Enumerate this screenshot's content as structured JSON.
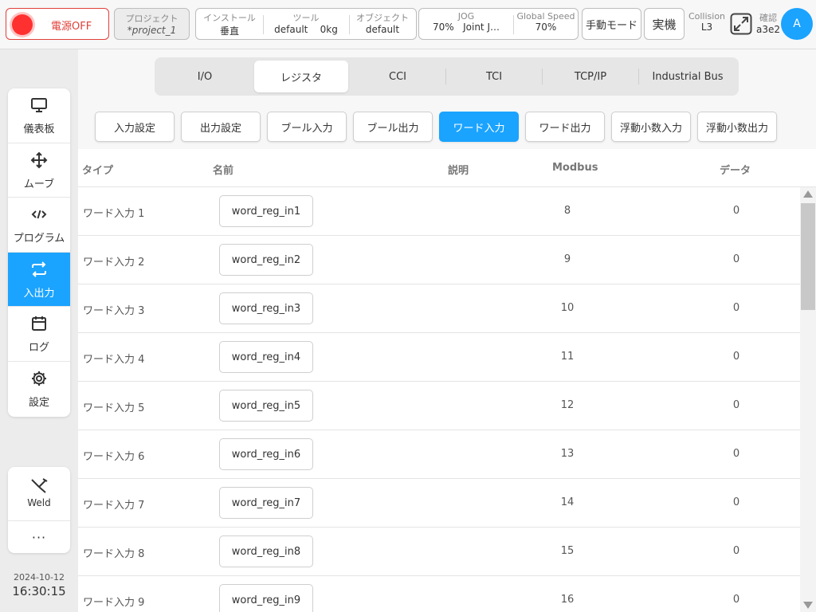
{
  "topbar": {
    "power_label": "電源OFF",
    "project_label": "プロジェクト",
    "project_value": "*project_1",
    "install_label": "インストール",
    "install_value": "垂直",
    "tool_label": "ツール",
    "tool_value": "default",
    "tool_payload": "0kg",
    "object_label": "オブジェクト",
    "object_value": "default",
    "jog_label": "JOG",
    "jog_value": "70%",
    "jog_mode": "Joint J…",
    "speed_label": "Global Speed",
    "speed_value": "70%",
    "manual_mode": "手動モード",
    "real_machine": "実機",
    "collision_label": "Collision",
    "collision_value": "L3",
    "confirm_label": "確認",
    "confirm_value": "a3e2",
    "avatar": "A"
  },
  "sidebar": {
    "items": [
      {
        "label": "儀表板",
        "icon": "monitor-icon"
      },
      {
        "label": "ムーブ",
        "icon": "move-arrows-icon"
      },
      {
        "label": "プログラム",
        "icon": "code-icon"
      },
      {
        "label": "入出力",
        "icon": "swap-arrows-icon"
      },
      {
        "label": "ログ",
        "icon": "calendar-icon"
      },
      {
        "label": "設定",
        "icon": "gear-icon"
      }
    ],
    "active_index": 3,
    "weld_label": "Weld",
    "more_label": "···",
    "date": "2024-10-12",
    "time": "16:30:15"
  },
  "tabs": [
    "I/O",
    "レジスタ",
    "CCI",
    "TCI",
    "TCP/IP",
    "Industrial Bus"
  ],
  "active_tab": 1,
  "subtabs": [
    "入力設定",
    "出力設定",
    "ブール入力",
    "ブール出力",
    "ワード入力",
    "ワード出力",
    "浮動小数入力",
    "浮動小数出力"
  ],
  "active_subtab": 4,
  "table": {
    "headers": {
      "type": "タイプ",
      "name": "名前",
      "description": "説明",
      "modbus": "Modbus",
      "data": "データ"
    },
    "rows": [
      {
        "type": "ワード入力 1",
        "name": "word_reg_in1",
        "modbus": "8",
        "data": "0"
      },
      {
        "type": "ワード入力 2",
        "name": "word_reg_in2",
        "modbus": "9",
        "data": "0"
      },
      {
        "type": "ワード入力 3",
        "name": "word_reg_in3",
        "modbus": "10",
        "data": "0"
      },
      {
        "type": "ワード入力 4",
        "name": "word_reg_in4",
        "modbus": "11",
        "data": "0"
      },
      {
        "type": "ワード入力 5",
        "name": "word_reg_in5",
        "modbus": "12",
        "data": "0"
      },
      {
        "type": "ワード入力 6",
        "name": "word_reg_in6",
        "modbus": "13",
        "data": "0"
      },
      {
        "type": "ワード入力 7",
        "name": "word_reg_in7",
        "modbus": "14",
        "data": "0"
      },
      {
        "type": "ワード入力 8",
        "name": "word_reg_in8",
        "modbus": "15",
        "data": "0"
      },
      {
        "type": "ワード入力 9",
        "name": "word_reg_in9",
        "modbus": "16",
        "data": "0"
      }
    ]
  },
  "colors": {
    "accent": "#1aa3ff",
    "power_red": "#e0403a"
  }
}
